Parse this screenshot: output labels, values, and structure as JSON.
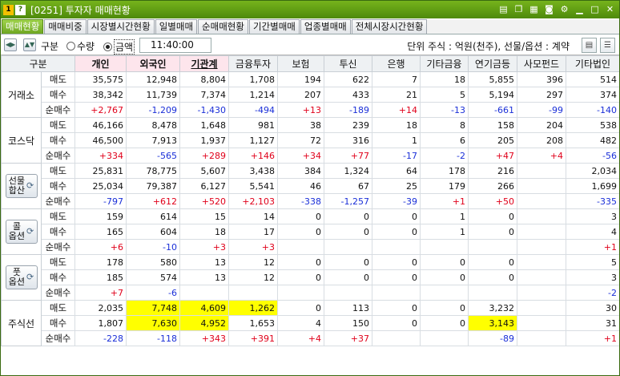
{
  "window": {
    "num1": "1",
    "num2": "?",
    "title": "[0251] 투자자 매매현황",
    "icons": [
      "chart-icon",
      "copy-icon",
      "print-icon",
      "camera-icon",
      "gear-icon",
      "minimize-icon",
      "restore-icon",
      "close-icon"
    ]
  },
  "tabs": [
    "매매현황",
    "매매비중",
    "시장별시간현황",
    "일별매매",
    "순매매현황",
    "기간별매매",
    "업종별매매",
    "전체시장시간현황"
  ],
  "toolbar": {
    "gubun_label": "구분",
    "radio_qty": "수량",
    "radio_amt": "금액",
    "time": "11:40:00",
    "unit": "단위 주식 : 억원(천주), 선물/옵션 : 계약"
  },
  "columns": [
    "구분",
    "개인",
    "외국인",
    "기관계",
    "금융투자",
    "보험",
    "투신",
    "은행",
    "기타금융",
    "연기금등",
    "사모펀드",
    "기타법인"
  ],
  "groups": [
    {
      "name": "거래소",
      "button": false,
      "rows": [
        {
          "label": "매도",
          "cells": [
            "35,575",
            "12,948",
            "8,804",
            "1,708",
            "194",
            "622",
            "7",
            "18",
            "5,855",
            "396",
            "514"
          ]
        },
        {
          "label": "매수",
          "cells": [
            "38,342",
            "11,739",
            "7,374",
            "1,214",
            "207",
            "433",
            "21",
            "5",
            "5,194",
            "297",
            "374"
          ]
        },
        {
          "label": "순매수",
          "cells": [
            "+2,767",
            "-1,209",
            "-1,430",
            "-494",
            "+13",
            "-189",
            "+14",
            "-13",
            "-661",
            "-99",
            "-140"
          ]
        }
      ]
    },
    {
      "name": "코스닥",
      "button": false,
      "rows": [
        {
          "label": "매도",
          "cells": [
            "46,166",
            "8,478",
            "1,648",
            "981",
            "38",
            "239",
            "18",
            "8",
            "158",
            "204",
            "538"
          ]
        },
        {
          "label": "매수",
          "cells": [
            "46,500",
            "7,913",
            "1,937",
            "1,127",
            "72",
            "316",
            "1",
            "6",
            "205",
            "208",
            "482"
          ]
        },
        {
          "label": "순매수",
          "cells": [
            "+334",
            "-565",
            "+289",
            "+146",
            "+34",
            "+77",
            "-17",
            "-2",
            "+47",
            "+4",
            "-56"
          ]
        }
      ]
    },
    {
      "name": "선물\n합산",
      "button": true,
      "rows": [
        {
          "label": "매도",
          "cells": [
            "25,831",
            "78,775",
            "5,607",
            "3,438",
            "384",
            "1,324",
            "64",
            "178",
            "216",
            "",
            "2,034"
          ]
        },
        {
          "label": "매수",
          "cells": [
            "25,034",
            "79,387",
            "6,127",
            "5,541",
            "46",
            "67",
            "25",
            "179",
            "266",
            "",
            "1,699"
          ]
        },
        {
          "label": "순매수",
          "cells": [
            "-797",
            "+612",
            "+520",
            "+2,103",
            "-338",
            "-1,257",
            "-39",
            "+1",
            "+50",
            "",
            "-335"
          ]
        }
      ]
    },
    {
      "name": "콜\n옵션",
      "button": true,
      "rows": [
        {
          "label": "매도",
          "cells": [
            "159",
            "614",
            "15",
            "14",
            "0",
            "0",
            "0",
            "1",
            "0",
            "",
            "3"
          ]
        },
        {
          "label": "매수",
          "cells": [
            "165",
            "604",
            "18",
            "17",
            "0",
            "0",
            "0",
            "1",
            "0",
            "",
            "4"
          ]
        },
        {
          "label": "순매수",
          "cells": [
            "+6",
            "-10",
            "+3",
            "+3",
            "",
            "",
            "",
            "",
            "",
            "",
            "+1"
          ]
        }
      ]
    },
    {
      "name": "풋\n옵션",
      "button": true,
      "rows": [
        {
          "label": "매도",
          "cells": [
            "178",
            "580",
            "13",
            "12",
            "0",
            "0",
            "0",
            "0",
            "0",
            "",
            "5"
          ]
        },
        {
          "label": "매수",
          "cells": [
            "185",
            "574",
            "13",
            "12",
            "0",
            "0",
            "0",
            "0",
            "0",
            "",
            "3"
          ]
        },
        {
          "label": "순매수",
          "cells": [
            "+7",
            "-6",
            "",
            "",
            "",
            "",
            "",
            "",
            "",
            "",
            "-2"
          ]
        }
      ]
    },
    {
      "name": "주식선",
      "button": false,
      "rows": [
        {
          "label": "매도",
          "cells": [
            "2,035",
            "7,748",
            "4,609",
            "1,262",
            "0",
            "113",
            "0",
            "0",
            "3,232",
            "",
            "30"
          ],
          "highlight": [
            1,
            2,
            3
          ]
        },
        {
          "label": "매수",
          "cells": [
            "1,807",
            "7,630",
            "4,952",
            "1,653",
            "4",
            "150",
            "0",
            "0",
            "3,143",
            "",
            "31"
          ],
          "highlight": [
            1,
            2,
            8
          ]
        },
        {
          "label": "순매수",
          "cells": [
            "-228",
            "-118",
            "+343",
            "+391",
            "+4",
            "+37",
            "",
            "",
            "-89",
            "",
            "+1"
          ],
          "highlight": [
            1,
            2,
            3,
            8
          ]
        }
      ]
    }
  ],
  "colors": {
    "accent": "#5d9a14",
    "up": "#e0001a",
    "down": "#1a2fd8",
    "highlight": "#ffff00",
    "header_hl": "#fde5ec"
  }
}
